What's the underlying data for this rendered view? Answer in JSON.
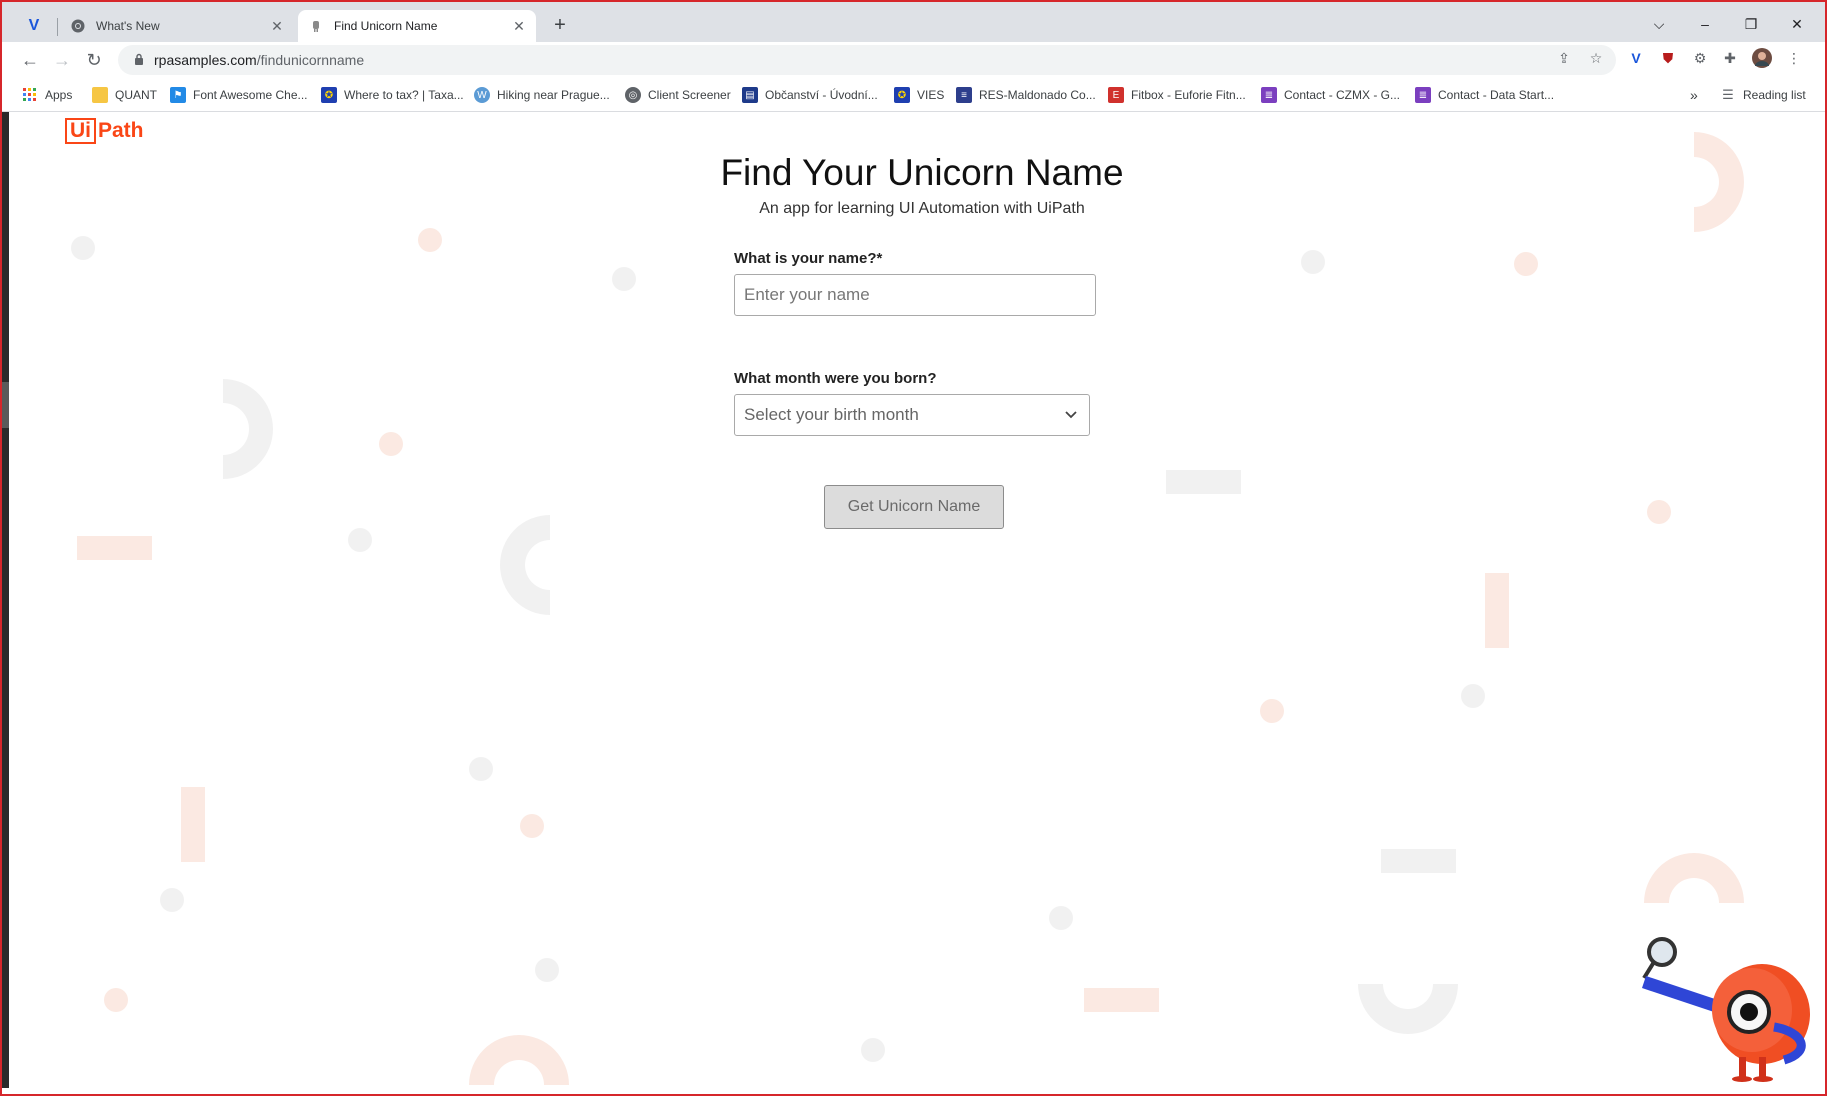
{
  "browser": {
    "tabs": [
      {
        "title": "What's New"
      },
      {
        "title": "Find Unicorn Name"
      }
    ],
    "new_tab_label": "+",
    "url_host": "rpasamples.com",
    "url_path": "/findunicornname",
    "window_controls": {
      "minimize": "–",
      "restore": "❐",
      "close": "✕"
    }
  },
  "bookmarks": {
    "items": [
      {
        "label": "Apps",
        "icon": "apps-grid-icon",
        "color": "#ea4335"
      },
      {
        "label": "QUANT",
        "icon": "folder-icon",
        "color": "#f6c644"
      },
      {
        "label": "Font Awesome Che...",
        "icon": "flag-icon",
        "color": "#228ae6"
      },
      {
        "label": "Where to tax? | Taxa...",
        "icon": "eu-flag-icon",
        "color": "#1f3fb0"
      },
      {
        "label": "Hiking near Prague...",
        "icon": "wordpress-icon",
        "color": "#5b9bd5"
      },
      {
        "label": "Client Screener",
        "icon": "globe-icon",
        "color": "#5f6368"
      },
      {
        "label": "Občanství - Úvodní...",
        "icon": "site-icon",
        "color": "#1e3a8a"
      },
      {
        "label": "VIES",
        "icon": "eu-flag-icon",
        "color": "#1f3fb0"
      },
      {
        "label": "RES-Maldonado Co...",
        "icon": "doc-icon",
        "color": "#2d3e8c"
      },
      {
        "label": "Fitbox - Euforie Fitn...",
        "icon": "fitbox-icon",
        "color": "#d0312d"
      },
      {
        "label": "Contact - CZMX - G...",
        "icon": "form-icon",
        "color": "#7b3fbf"
      },
      {
        "label": "Contact - Data Start...",
        "icon": "form-icon",
        "color": "#7b3fbf"
      }
    ],
    "overflow": "»",
    "reading_list": "Reading list"
  },
  "page": {
    "logo_boxed": "Ui",
    "logo_rest": "Path",
    "title": "Find Your Unicorn Name",
    "subtitle": "An app for learning UI Automation with UiPath",
    "name_label": "What is your name?*",
    "name_placeholder": "Enter your name",
    "month_label": "What month were you born?",
    "month_selected": "Select your birth month",
    "submit_label": "Get Unicorn Name"
  },
  "colors": {
    "brand": "#fa4616",
    "frame": "#d6262b",
    "deco_orange": "#fbe9e2",
    "deco_gray": "#f1f1f1"
  }
}
